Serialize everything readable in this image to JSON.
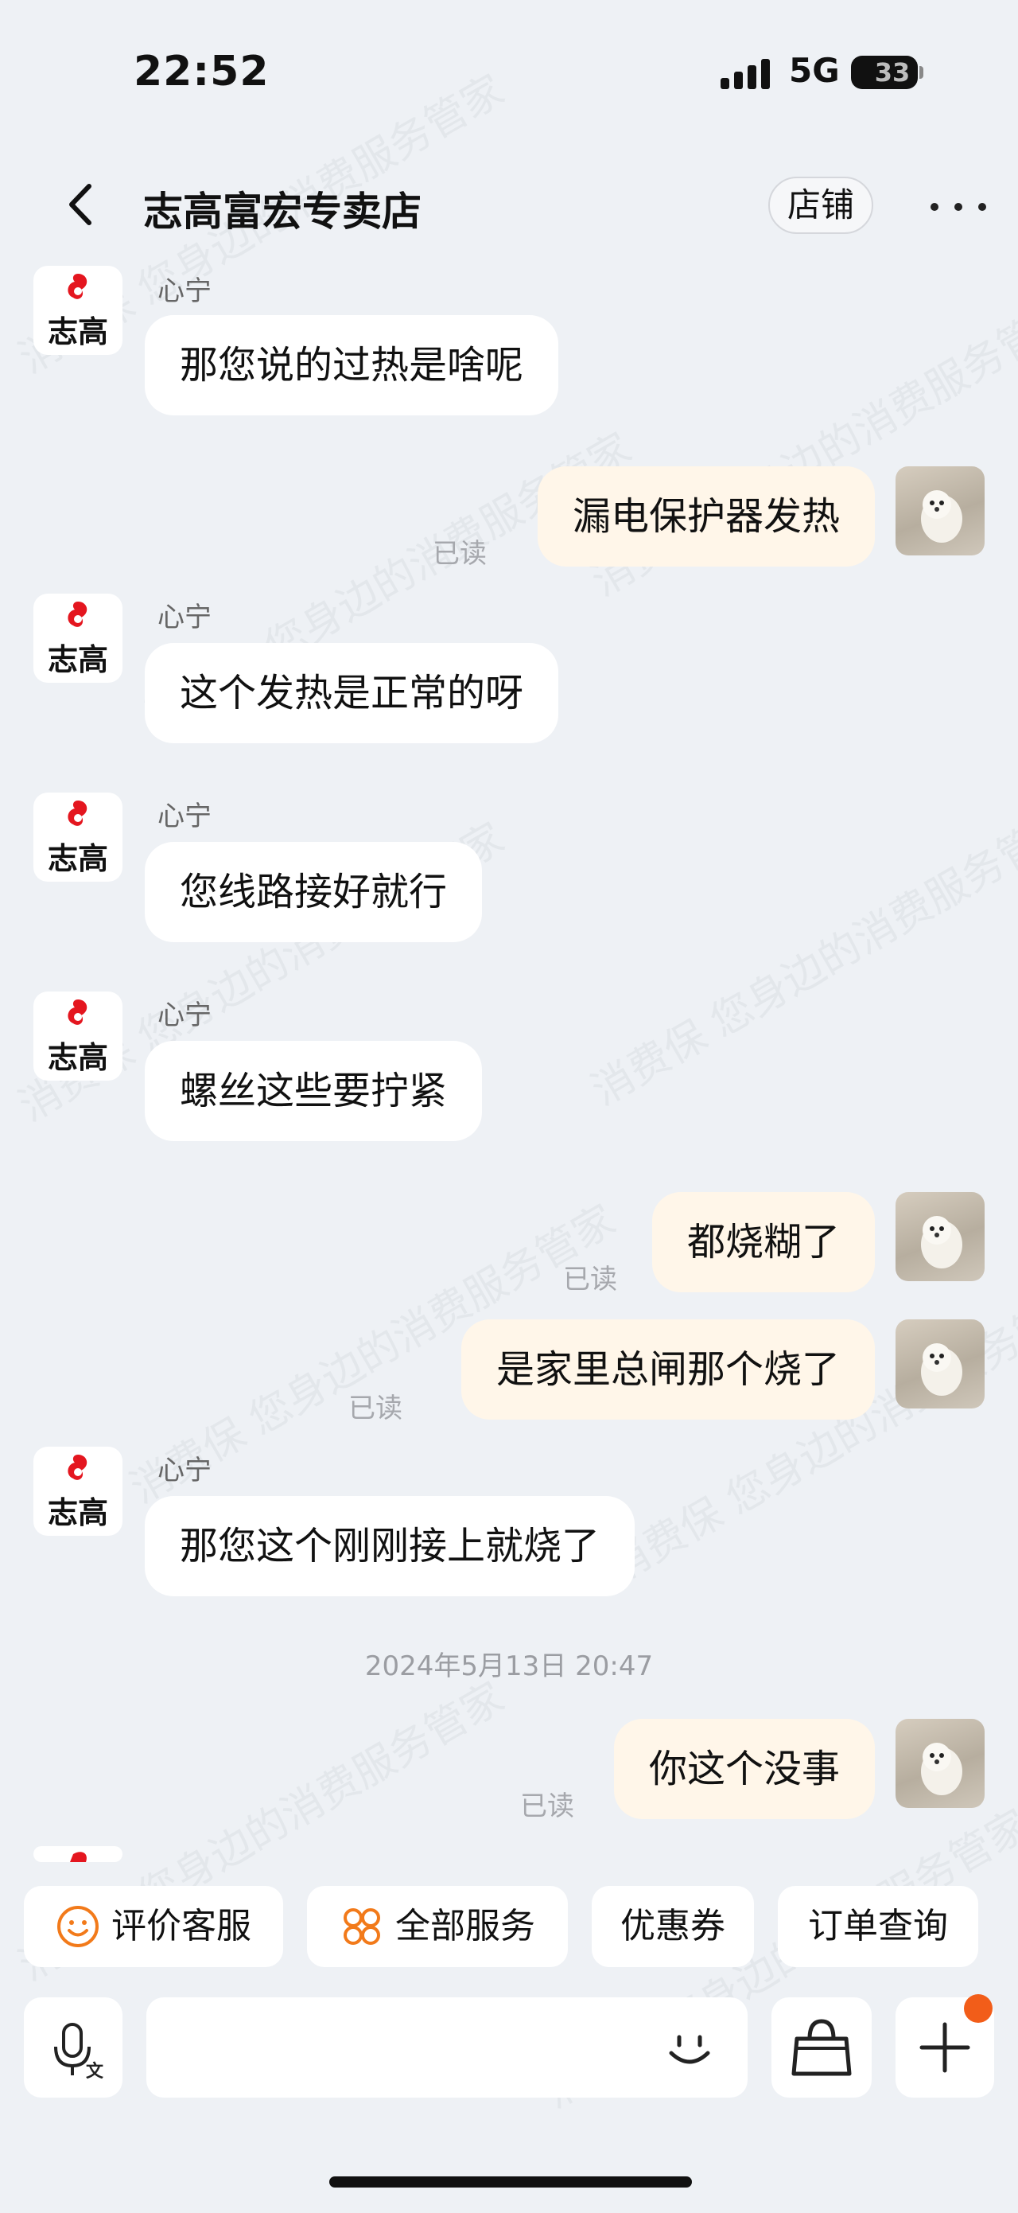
{
  "status_bar": {
    "time": "22:52",
    "network": "5G",
    "battery": "33"
  },
  "nav": {
    "title": "志高富宏专卖店",
    "shop_button": "店铺"
  },
  "watermark": "消费保 您身边的消费服务管家",
  "colors": {
    "background": "#eef1f5",
    "outgoing_bubble": "#fff6e9",
    "incoming_bubble": "#ffffff",
    "logo_red": "#e4161f",
    "accent_orange": "#f25d19"
  },
  "messages": [
    {
      "side": "left",
      "sender": "心宁",
      "text": "那您说的过热是啥呢"
    },
    {
      "side": "right",
      "text": "漏电保护器发热",
      "status": "已读"
    },
    {
      "side": "left",
      "sender": "心宁",
      "text": "这个发热是正常的呀"
    },
    {
      "side": "left",
      "sender": "心宁",
      "text": "您线路接好就行"
    },
    {
      "side": "left",
      "sender": "心宁",
      "text": "螺丝这些要拧紧"
    },
    {
      "side": "right",
      "text": "都烧糊了",
      "status": "已读"
    },
    {
      "side": "right",
      "text": "是家里总闸那个烧了",
      "status": "已读"
    },
    {
      "side": "left",
      "sender": "心宁",
      "text": "那您这个刚刚接上就烧了"
    },
    {
      "side": "right",
      "text": "你这个没事",
      "status": "已读"
    }
  ],
  "timestamp": "2024年5月13日 20:47",
  "avatar_logo_text": "志高",
  "quick_actions": [
    "评价客服",
    "全部服务",
    "优惠券",
    "订单查询"
  ],
  "icons": [
    "chevron-left-icon",
    "more-dots-icon",
    "smile-face-icon",
    "grid-flower-icon",
    "voice-input-icon",
    "emoji-icon",
    "shopping-bag-icon",
    "plus-icon"
  ]
}
